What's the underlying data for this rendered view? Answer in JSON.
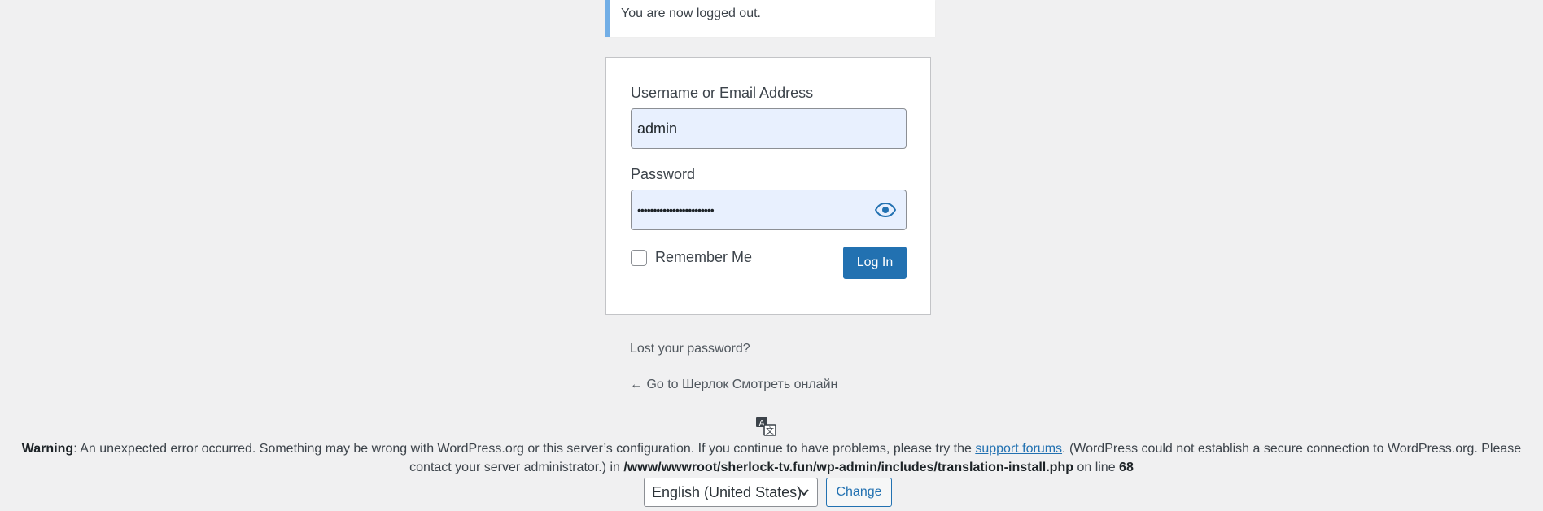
{
  "notice": {
    "message": "You are now logged out."
  },
  "login_form": {
    "username_label": "Username or Email Address",
    "username_value": "admin",
    "password_label": "Password",
    "password_value": "••••••••••••••••••••••••",
    "password_toggle_icon": "eye-icon",
    "remember_label": "Remember Me",
    "remember_checked": false,
    "submit_label": "Log In"
  },
  "links": {
    "lost_password": "Lost your password?",
    "back_to_site": "← Go to Шерлок Смотреть онлайн"
  },
  "translate_icon": "translation-icon",
  "warning": {
    "label": "Warning",
    "text_before_link": ": An unexpected error occurred. Something may be wrong with WordPress.org or this server’s configuration. If you continue to have problems, please try the ",
    "link_text": "support forums",
    "text_after_link": ". (WordPress could not establish a secure connection to WordPress.org. Please contact your server administrator.) in ",
    "file_path": "/www/wwwroot/sherlock-tv.fun/wp-admin/includes/translation-install.php",
    "on_line_text": " on line ",
    "line_number": "68"
  },
  "language": {
    "selected": "English (United States)",
    "change_label": "Change"
  },
  "colors": {
    "accent": "#2271b1",
    "notice_border": "#72aee6",
    "background": "#f0f0f1",
    "autofill": "#e8f0fe"
  }
}
